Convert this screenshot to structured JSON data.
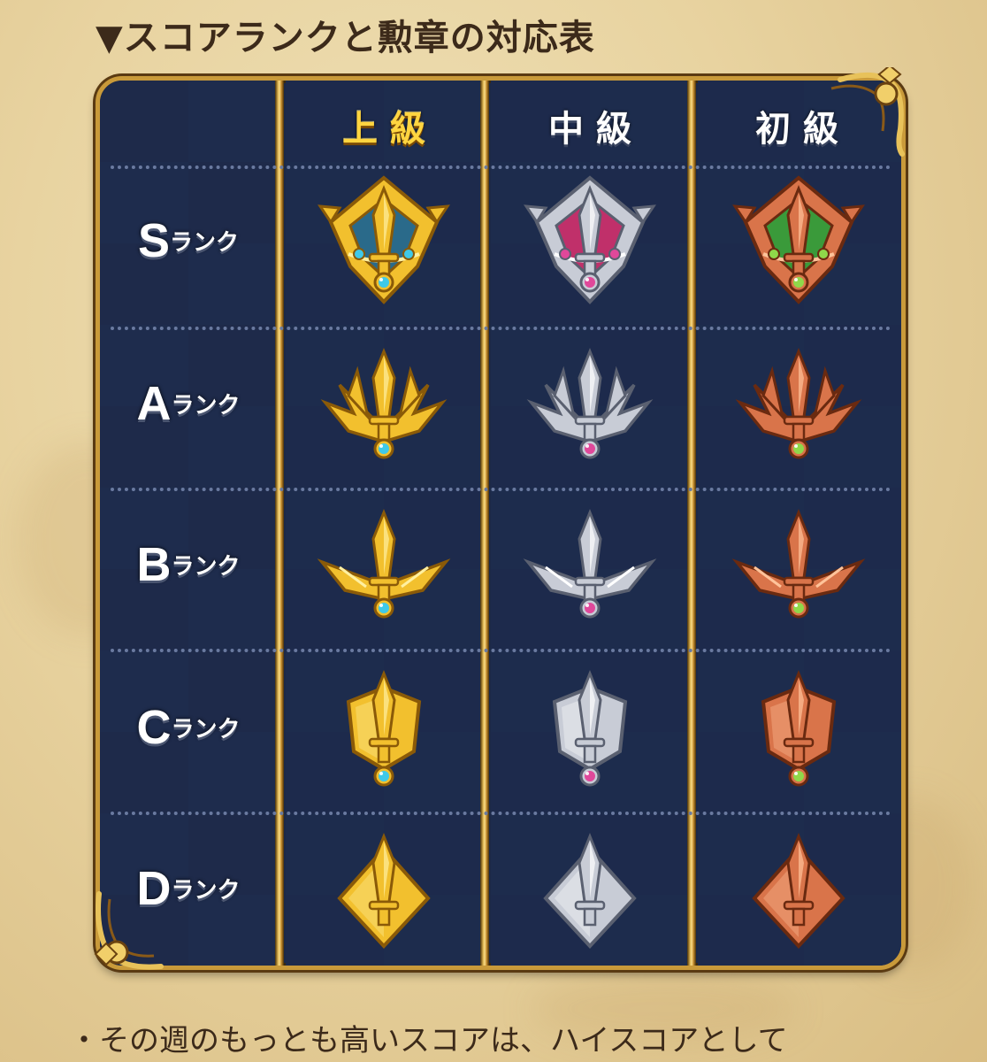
{
  "heading": "▼スコアランクと勲章の対応表",
  "columns": [
    {
      "label": "上級",
      "tier": "gold",
      "gem": "blue"
    },
    {
      "label": "中級",
      "tier": "silver",
      "gem": "pink"
    },
    {
      "label": "初級",
      "tier": "bronze",
      "gem": "green"
    }
  ],
  "ranks": [
    {
      "letter": "S",
      "suffix": "ランク"
    },
    {
      "letter": "A",
      "suffix": "ランク"
    },
    {
      "letter": "B",
      "suffix": "ランク"
    },
    {
      "letter": "C",
      "suffix": "ランク"
    },
    {
      "letter": "D",
      "suffix": "ランク"
    }
  ],
  "note": "・その週のもっとも高いスコアは、ハイスコアとして",
  "colors": {
    "board_bg": "#1c2947",
    "frame_gold": "#c99a3a",
    "gold_medal": "#f2c02e",
    "silver_medal": "#c8ccd6",
    "bronze_medal": "#d9744a",
    "gem_blue": "#3fc9e8",
    "gem_pink": "#e0489a",
    "gem_green": "#8fd84a",
    "s_inlay_gold": "#2a6a8a",
    "s_inlay_silver": "#c0306a",
    "s_inlay_bronze": "#3a9a3a"
  }
}
